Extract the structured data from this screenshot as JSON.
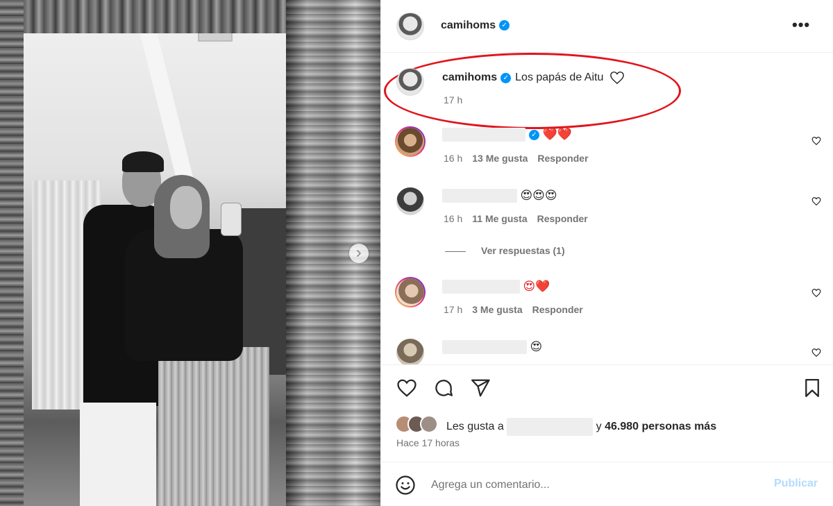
{
  "header": {
    "username": "camihoms",
    "more_label": "•••"
  },
  "caption": {
    "username": "camihoms",
    "text": "Los papás de Aitu",
    "time": "17 h"
  },
  "comments": [
    {
      "emojis": "❤️❤️",
      "verified": true,
      "time": "16 h",
      "likes": "13 Me gusta",
      "reply_label": "Responder"
    },
    {
      "emojis": "😍😍😍",
      "verified": false,
      "time": "16 h",
      "likes": "11 Me gusta",
      "reply_label": "Responder",
      "view_replies": "Ver respuestas (1)"
    },
    {
      "emojis": "😍❤️",
      "verified": false,
      "time": "17 h",
      "likes": "3 Me gusta",
      "reply_label": "Responder"
    },
    {
      "emojis": "😍",
      "verified": false
    }
  ],
  "likes": {
    "prefix": "Les gusta a",
    "connector": "y",
    "others": "46.980 personas más",
    "time_ago": "Hace 17 horas"
  },
  "composer": {
    "placeholder": "Agrega un comentario...",
    "post_label": "Publicar"
  },
  "colors": {
    "verified_blue": "#0095f6",
    "highlight_red": "#e1141d",
    "post_disabled": "#b3dbff",
    "secondary_text": "#737373"
  },
  "icons": [
    "chevron-right-icon",
    "verified-badge-icon",
    "more-options-icon",
    "heart-icon",
    "comment-icon",
    "share-icon",
    "bookmark-icon",
    "emoji-icon"
  ]
}
